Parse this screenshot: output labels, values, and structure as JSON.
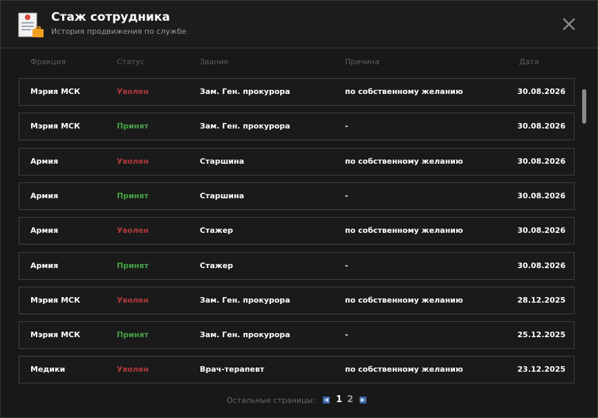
{
  "header": {
    "title": "Стаж сотрудника",
    "subtitle": "История продвижения по службе"
  },
  "columns": [
    "Фракция",
    "Статус",
    "Звание",
    "Причина",
    "Дата"
  ],
  "rows": [
    {
      "faction": "Мэрия МСК",
      "status": "Уволен",
      "status_type": "fired",
      "rank": "Зам. Ген. прокурора",
      "reason": "по собственному желанию",
      "date": "30.08.2026"
    },
    {
      "faction": "Мэрия МСК",
      "status": "Принят",
      "status_type": "hired",
      "rank": "Зам. Ген. прокурора",
      "reason": "-",
      "date": "30.08.2026"
    },
    {
      "faction": "Армия",
      "status": "Уволен",
      "status_type": "fired",
      "rank": "Старшина",
      "reason": "по собственному желанию",
      "date": "30.08.2026"
    },
    {
      "faction": "Армия",
      "status": "Принят",
      "status_type": "hired",
      "rank": "Старшина",
      "reason": "-",
      "date": "30.08.2026"
    },
    {
      "faction": "Армия",
      "status": "Уволен",
      "status_type": "fired",
      "rank": "Стажер",
      "reason": "по собственному желанию",
      "date": "30.08.2026"
    },
    {
      "faction": "Армия",
      "status": "Принят",
      "status_type": "hired",
      "rank": "Стажер",
      "reason": "-",
      "date": "30.08.2026"
    },
    {
      "faction": "Мэрия МСК",
      "status": "Уволен",
      "status_type": "fired",
      "rank": "Зам. Ген. прокурора",
      "reason": "по собственному желанию",
      "date": "28.12.2025"
    },
    {
      "faction": "Мэрия МСК",
      "status": "Принят",
      "status_type": "hired",
      "rank": "Зам. Ген. прокурора",
      "reason": "-",
      "date": "25.12.2025"
    },
    {
      "faction": "Медики",
      "status": "Уволен",
      "status_type": "fired",
      "rank": "Врач-терапевт",
      "reason": "по собственному желанию",
      "date": "23.12.2025"
    }
  ],
  "pagination": {
    "label": "Остальные страницы:",
    "pages": [
      "1",
      "2"
    ],
    "current": "1"
  },
  "icons": {
    "app": "document-briefcase-icon",
    "close": "close-icon",
    "prev": "chevron-left-icon",
    "next": "chevron-right-icon"
  },
  "colors": {
    "fired": "#b13a3a",
    "hired": "#46a346",
    "background": "#181818",
    "page_button": "#3d6aa8"
  }
}
